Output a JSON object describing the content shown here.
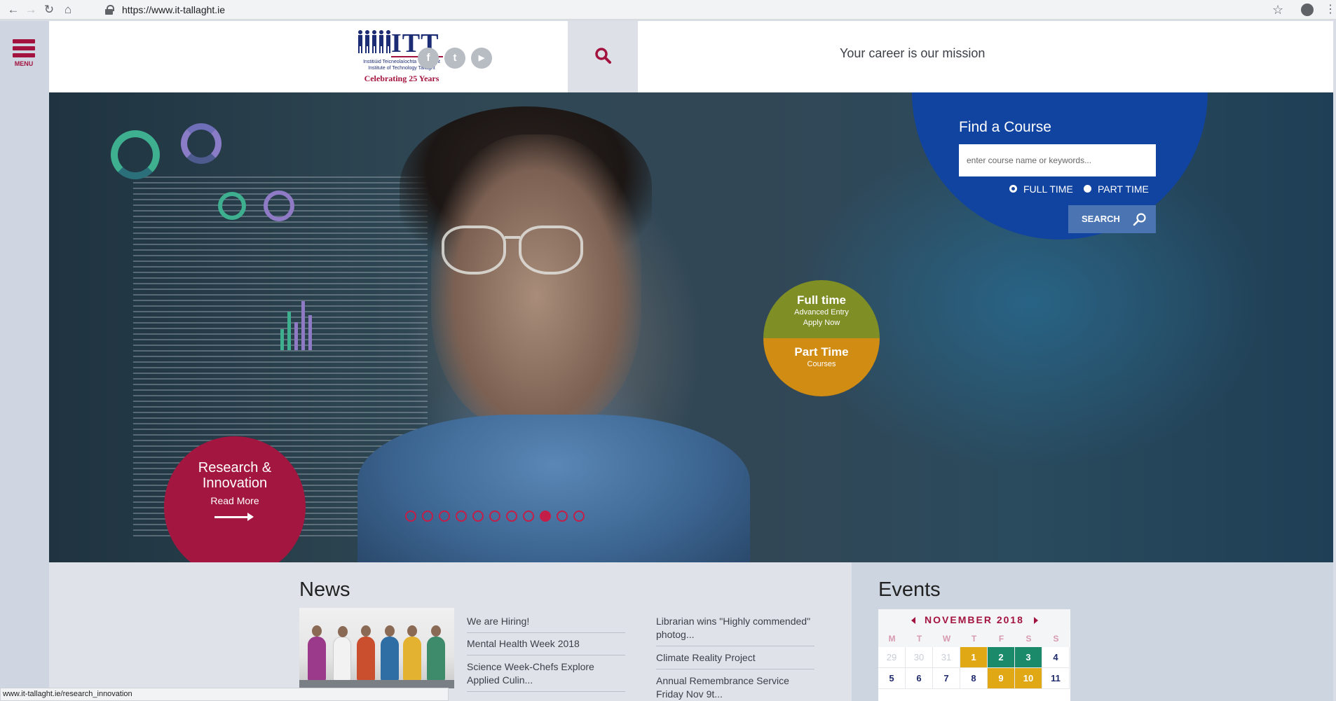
{
  "browser": {
    "url": "https://www.it-tallaght.ie",
    "status_url": "www.it-tallaght.ie/research_innovation"
  },
  "header": {
    "menu_label": "MENU",
    "logo": {
      "wordmark": "ITT",
      "line1": "Institiúid Teicneolaíochta Tamhlacht",
      "line2": "Institute of Technology Tallaght",
      "celebrating": "Celebrating 25 Years"
    },
    "social": [
      {
        "icon": "facebook-icon",
        "glyph": "f"
      },
      {
        "icon": "twitter-icon",
        "glyph": "t"
      },
      {
        "icon": "youtube-icon",
        "glyph": "▶"
      }
    ],
    "tagline": "Your career is our mission"
  },
  "find_course": {
    "title": "Find a Course",
    "placeholder": "enter course name or keywords...",
    "option_full": "FULL TIME",
    "option_part": "PART TIME",
    "selected": "FULL TIME",
    "search_label": "SEARCH"
  },
  "promo": {
    "full_title": "Full time",
    "full_line1": "Advanced Entry",
    "full_line2": "Apply Now",
    "part_title": "Part Time",
    "part_line1": "Courses"
  },
  "research": {
    "title": "Research & Innovation",
    "link": "Read More"
  },
  "carousel": {
    "slide_count": 11,
    "active_index": 8
  },
  "news": {
    "title": "News",
    "col1": [
      "We are Hiring!",
      "Mental Health Week 2018",
      "Science Week-Chefs Explore Applied Culin..."
    ],
    "col2": [
      "Librarian wins \"Highly commended\" photog...",
      "Climate Reality Project",
      "Annual Remembrance Service Friday Nov 9t..."
    ]
  },
  "events": {
    "title": "Events",
    "month": "NOVEMBER 2018",
    "weekdays": [
      "M",
      "T",
      "W",
      "T",
      "F",
      "S",
      "S"
    ],
    "week1": [
      "29",
      "30",
      "31",
      "1",
      "2",
      "3",
      "4"
    ],
    "week2": [
      "5",
      "6",
      "7",
      "8",
      "9",
      "10",
      "11"
    ]
  },
  "colors": {
    "brand_red": "#a3133f",
    "course_blue": "#1144a0",
    "olive": "#7f8e25",
    "gold": "#d18c13",
    "event_green": "#1b8a6a"
  }
}
